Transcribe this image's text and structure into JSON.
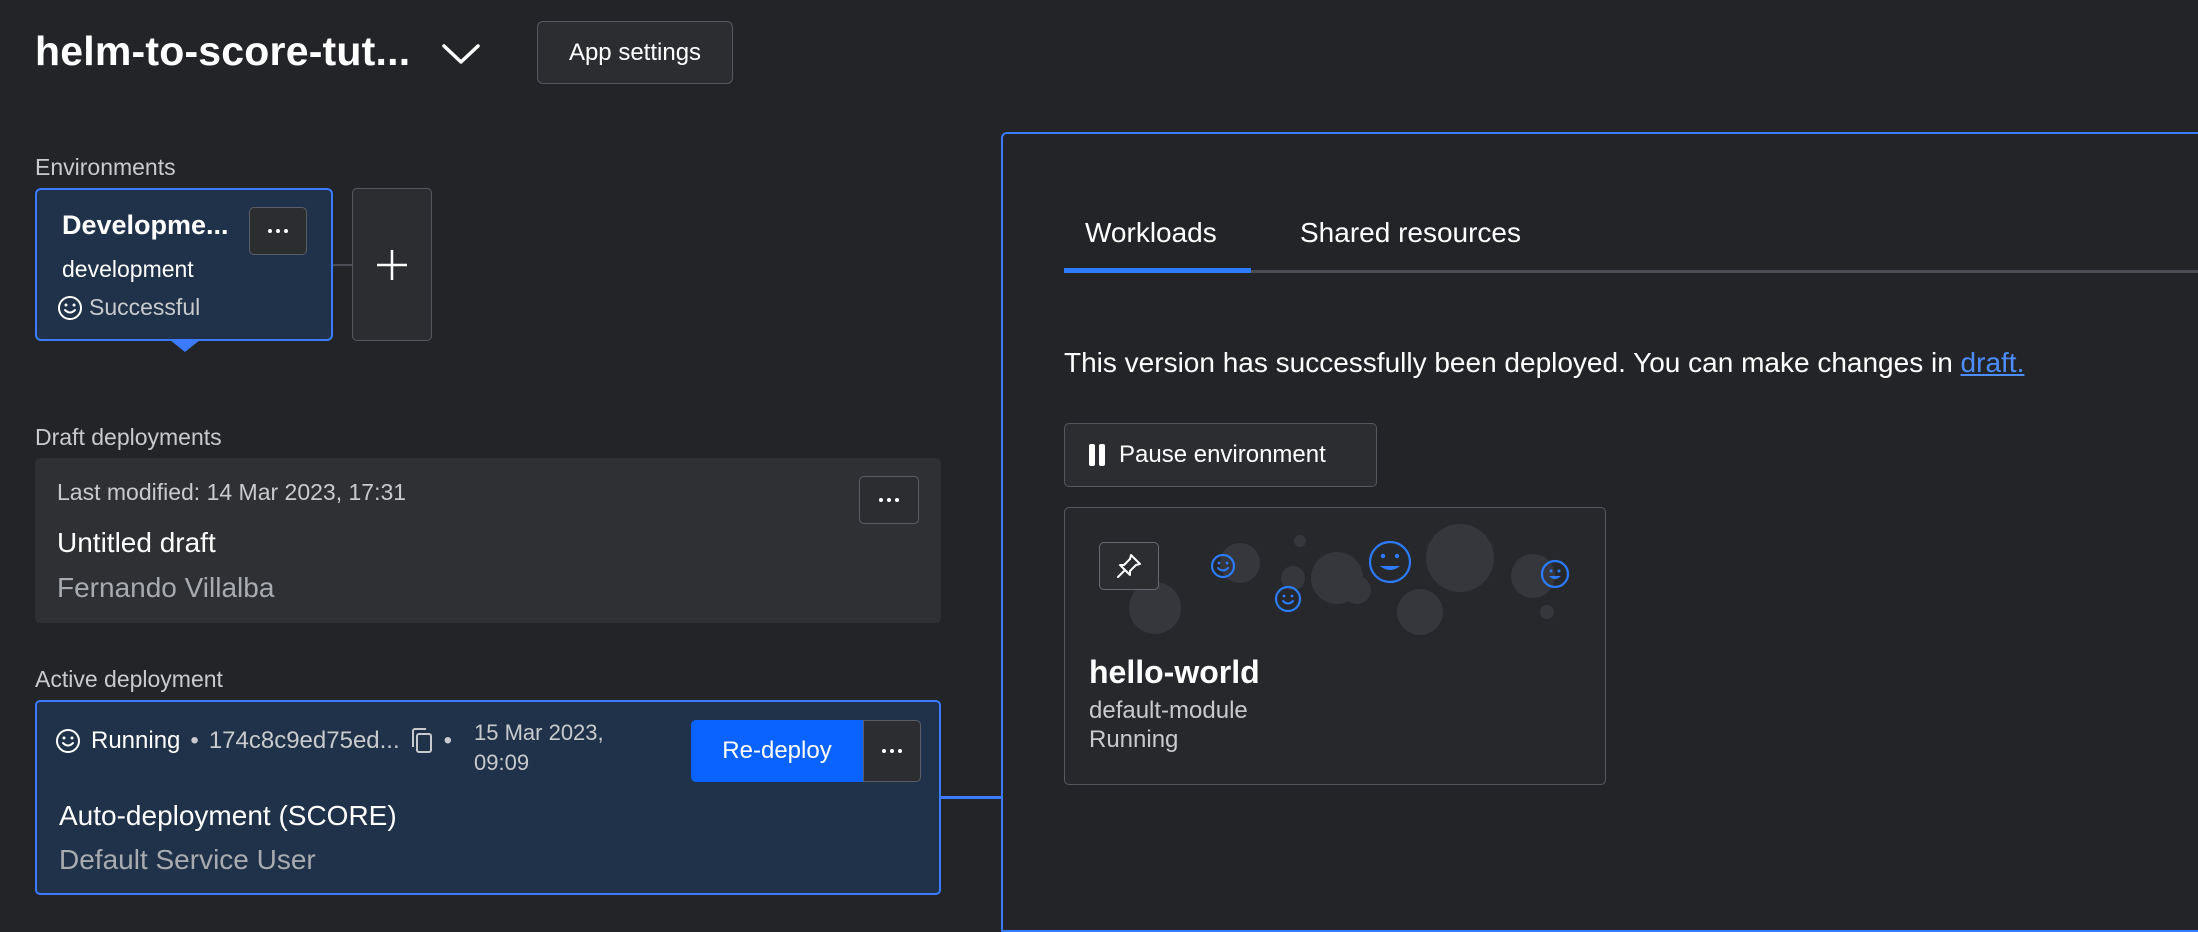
{
  "header": {
    "app_title": "helm-to-score-tut...",
    "app_settings_label": "App settings"
  },
  "environments": {
    "section_label": "Environments",
    "card": {
      "name": "Developme...",
      "id": "development",
      "status": "Successful"
    }
  },
  "draft": {
    "section_label": "Draft deployments",
    "last_modified": "Last modified: 14 Mar 2023, 17:31",
    "title": "Untitled draft",
    "author": "Fernando Villalba"
  },
  "active": {
    "section_label": "Active deployment",
    "status": "Running",
    "commit": "174c8c9ed75ed...",
    "date_line1": "15 Mar 2023,",
    "date_line2": "09:09",
    "redeploy_label": "Re-deploy",
    "title": "Auto-deployment (SCORE)",
    "author": "Default Service User"
  },
  "panel": {
    "tabs": [
      {
        "label": "Workloads",
        "active": true
      },
      {
        "label": "Shared resources",
        "active": false
      }
    ],
    "message_prefix": "This version has successfully been deployed. You can make changes in ",
    "message_link": "draft.",
    "pause_label": "Pause environment",
    "workload": {
      "name": "hello-world",
      "module": "default-module",
      "status": "Running"
    }
  },
  "colors": {
    "accent": "#3a7bff",
    "button_primary": "#0a63ff",
    "background": "#232427"
  }
}
